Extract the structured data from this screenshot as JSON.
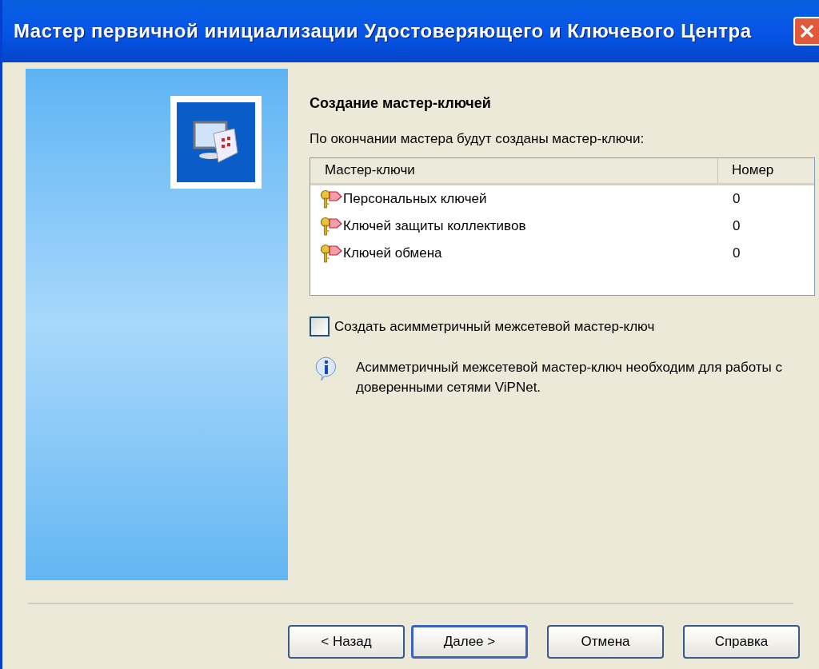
{
  "window": {
    "title": "Мастер первичной инициализации Удостоверяющего и Ключевого Центра"
  },
  "page": {
    "heading": "Создание мастер-ключей",
    "intro": "По окончании мастера будут созданы мастер-ключи:"
  },
  "table": {
    "columns": [
      "Мастер-ключи",
      "Номер"
    ],
    "rows": [
      {
        "name": "Персональных ключей",
        "number": "0"
      },
      {
        "name": "Ключей защиты коллективов",
        "number": "0"
      },
      {
        "name": "Ключей обмена",
        "number": "0"
      }
    ]
  },
  "checkbox": {
    "label": "Создать асимметричный межсетевой мастер-ключ",
    "checked": false
  },
  "info": {
    "text": "Асимметричный межсетевой мастер-ключ необходим для работы с доверенными сетями ViPNet."
  },
  "buttons": [
    {
      "label": "< Назад",
      "default": false
    },
    {
      "label": "Далее >",
      "default": true
    },
    {
      "label": "Отмена",
      "default": false
    },
    {
      "label": "Справка",
      "default": false
    }
  ]
}
